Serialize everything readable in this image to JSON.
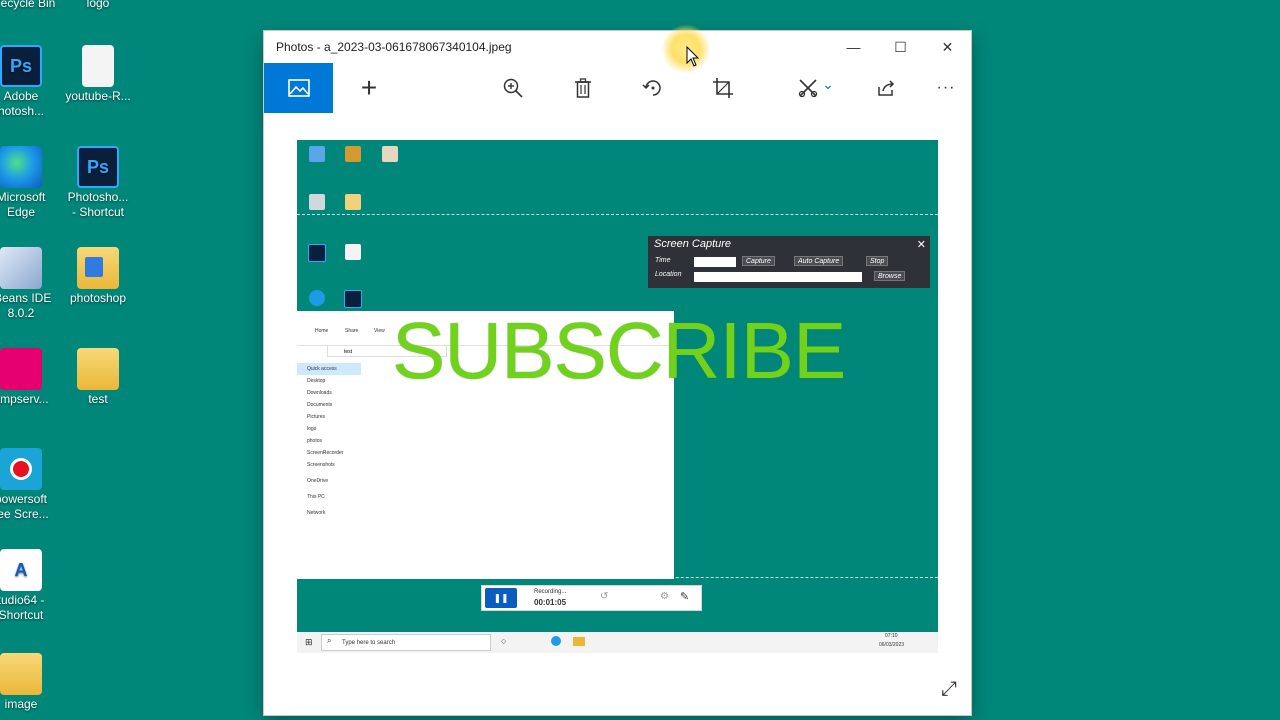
{
  "desktop": {
    "icons": [
      {
        "label": "ecycle Bin"
      },
      {
        "label": "logo"
      },
      {
        "label": "Adobe"
      },
      {
        "label": "hotosh..."
      },
      {
        "label": "youtube-R..."
      },
      {
        "label": "Microsoft"
      },
      {
        "label": "Edge"
      },
      {
        "label": "Photosho..."
      },
      {
        "label": "- Shortcut"
      },
      {
        "label": "tBeans IDE"
      },
      {
        "label": "8.0.2"
      },
      {
        "label": "photoshop"
      },
      {
        "label": "ampserv..."
      },
      {
        "label": "test"
      },
      {
        "label": "powersoft"
      },
      {
        "label": "ree Scre..."
      },
      {
        "label": "tudio64 -"
      },
      {
        "label": "Shortcut"
      },
      {
        "label": "image"
      }
    ],
    "ps_glyph": "Ps",
    "a_glyph": "A"
  },
  "window": {
    "title": "Photos - a_2023-03-061678067340104.jpeg",
    "controls": {
      "minimize": "—",
      "maximize": "☐",
      "close": "✕"
    }
  },
  "toolbar": {
    "icons": {
      "see_all": "🖼",
      "add": "+",
      "zoom": "⊕",
      "delete": "🗑",
      "rotate": "↻",
      "crop": "⌗",
      "edit": "✂",
      "edit_chevron": "⌄",
      "share": "⇪",
      "more": "···"
    }
  },
  "screenshot": {
    "screen_capture": {
      "title": "Screen Capture",
      "close": "✕",
      "time_label": "Time",
      "location_label": "Location",
      "capture_btn": "Capture",
      "auto_capture_btn": "Auto Capture",
      "stop_btn": "Stop",
      "browse_btn": "Browse"
    },
    "explorer": {
      "ribbon_tabs": [
        "Home",
        "Share",
        "View"
      ],
      "address": "test",
      "sidebar": [
        "Quick access",
        "Desktop",
        "Downloads",
        "Documents",
        "Pictures",
        "logo",
        "photos",
        "ScreenRecorder",
        "Screenshots",
        "OneDrive",
        "This PC",
        "Network"
      ]
    },
    "overlay_text": "SUBSCRIBE",
    "recorder": {
      "status": "Recording...",
      "time": "00:01:05",
      "pause": "❚❚"
    },
    "taskbar": {
      "search_placeholder": "Type here to search",
      "clock_time": "07:10",
      "clock_date": "06/03/2023"
    }
  },
  "expand_icon": "⤢"
}
